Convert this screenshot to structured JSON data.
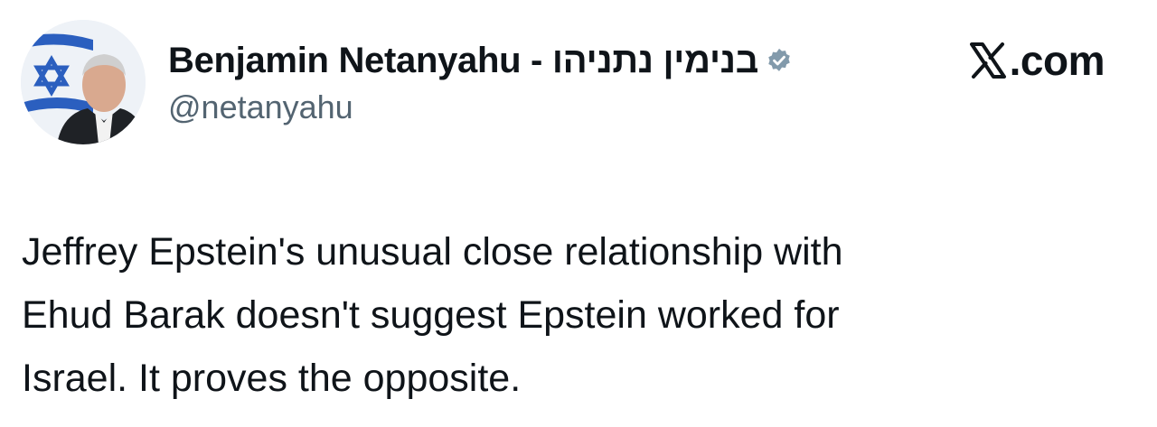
{
  "author": {
    "display_name": "Benjamin Netanyahu - בנימין נתניהו",
    "handle": "@netanyahu",
    "verified": true,
    "avatar_icon": "profile-photo-with-israeli-flag"
  },
  "brand": {
    "logo_icon": "x-logo-icon",
    "text": ".com"
  },
  "tweet": {
    "lines": [
      "Jeffrey Epstein's unusual close relationship with",
      "Ehud Barak doesn't suggest Epstein worked for",
      "Israel. It proves the opposite."
    ]
  },
  "colors": {
    "text": "#0f1419",
    "secondary_text": "#536471",
    "verified_badge": "#829aab",
    "flag_blue": "#0038b8"
  }
}
